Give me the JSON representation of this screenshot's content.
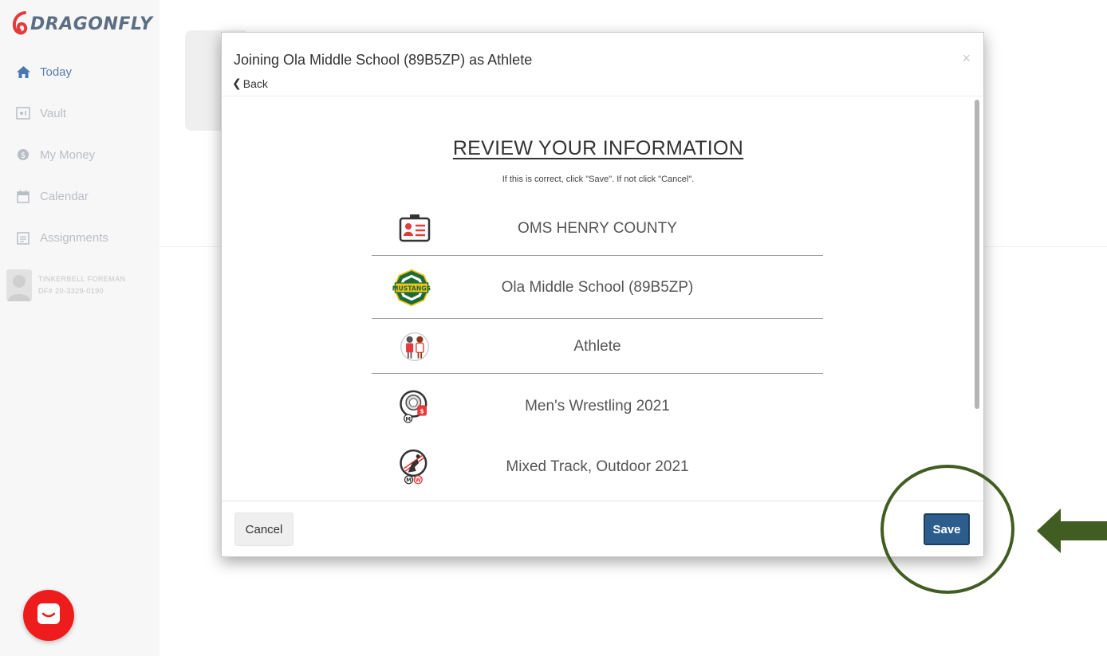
{
  "app": {
    "brand": "DRAGONFLY",
    "brand_color": "#5b6f84",
    "accent_color": "#2c5d8c"
  },
  "sidebar": {
    "items": [
      {
        "label": "Today",
        "icon": "home-icon",
        "active": true
      },
      {
        "label": "Vault",
        "icon": "vault-icon",
        "active": false
      },
      {
        "label": "My Money",
        "icon": "money-icon",
        "active": false
      },
      {
        "label": "Calendar",
        "icon": "calendar-icon",
        "active": false
      },
      {
        "label": "Assignments",
        "icon": "assignments-icon",
        "active": false
      }
    ],
    "user": {
      "name": "TINKERBELL FOREMAN",
      "id": "DF# 20-3329-0190"
    }
  },
  "modal": {
    "title": "Joining Ola Middle School (89B5ZP) as Athlete",
    "back_label": "Back",
    "close_glyph": "×",
    "review_title": "REVIEW YOUR INFORMATION",
    "review_subtitle": "If this is correct, click \"Save\". If not click \"Cancel\".",
    "rows": [
      {
        "label": "OMS HENRY COUNTY",
        "icon": "id-card-icon"
      },
      {
        "label": "Ola Middle School (89B5ZP)",
        "icon": "mustangs-logo-icon",
        "logo_text": "MUSTANGS"
      },
      {
        "label": "Athlete",
        "icon": "athlete-icon"
      },
      {
        "label": "Men's Wrestling 2021",
        "icon": "wrestling-icon"
      },
      {
        "label": "Mixed Track, Outdoor 2021",
        "icon": "track-icon"
      }
    ],
    "cancel_label": "Cancel",
    "save_label": "Save"
  },
  "annotation": {
    "color": "#425d22"
  }
}
